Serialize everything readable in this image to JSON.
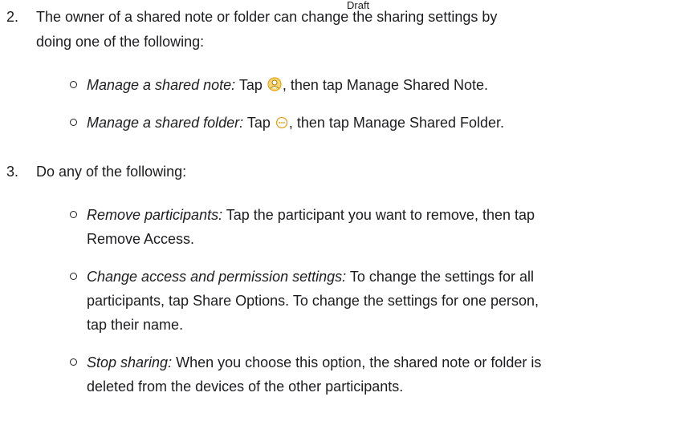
{
  "watermark": "Draft",
  "step2": {
    "number": "2.",
    "line1": "The owner of a shared note or folder can change the sharing settings by",
    "line2": "doing one of the following:",
    "items": [
      {
        "term": "Manage a shared note:",
        "before_icon": "Tap",
        "icon": "share-participant-icon",
        "after_icon": ", then tap Manage Shared Note."
      },
      {
        "term": "Manage a shared folder:",
        "before_icon": "Tap",
        "icon": "more-icon",
        "after_icon": ", then tap Manage Shared Folder."
      }
    ]
  },
  "step3": {
    "number": "3.",
    "line1": "Do any of the following:",
    "items": [
      {
        "term": "Remove participants:",
        "lines": [
          "Tap the participant you want to remove, then tap",
          "Remove Access."
        ]
      },
      {
        "term": "Change access and permission settings:",
        "lines": [
          "To change the settings for all",
          "participants, tap Share Options. To change the settings for one person,",
          "tap their name."
        ]
      },
      {
        "term": "Stop sharing:",
        "lines": [
          "When you choose this option, the shared note or folder is",
          "deleted from the devices of the other participants."
        ]
      }
    ]
  },
  "colors": {
    "text": "#1d1d1f",
    "icon_accent": "#e8a317",
    "background": "#ffffff"
  }
}
